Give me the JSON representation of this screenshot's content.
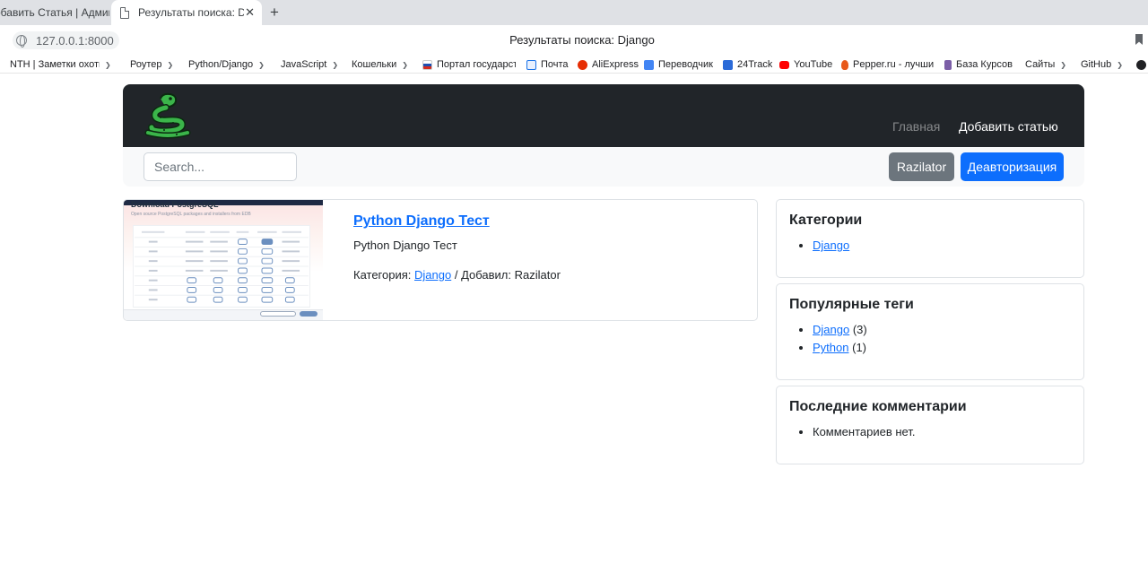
{
  "browser": {
    "tabs": [
      {
        "title": "обавить Статья | Админ...",
        "active": false
      },
      {
        "title": "Результаты поиска: Django",
        "active": true
      }
    ],
    "new_tab": "+",
    "url": "127.0.0.1:8000",
    "page_title": "Результаты поиска: Django",
    "bookmarks": [
      {
        "label": "NTH | Заметки охотн...",
        "folder": true
      },
      {
        "label": "Роутер",
        "folder": true
      },
      {
        "label": "Python/Django",
        "folder": true
      },
      {
        "label": "JavaScript",
        "folder": true
      },
      {
        "label": "Кошельки",
        "folder": true
      },
      {
        "label": "Портал государст...",
        "folder": false,
        "icon_color": "#1e4fb0"
      },
      {
        "label": "Почта",
        "folder": false,
        "icon_color": "#1a73e8"
      },
      {
        "label": "AliExpress",
        "folder": false,
        "icon_color": "#e62e04"
      },
      {
        "label": "Переводчик",
        "folder": false,
        "icon_color": "#4285f4"
      },
      {
        "label": "24Track",
        "folder": false,
        "icon_color": "#2a6ad8"
      },
      {
        "label": "YouTube",
        "folder": false,
        "icon_color": "#ff0000"
      },
      {
        "label": "Pepper.ru - лучши...",
        "folder": false,
        "icon_color": "#e8591a"
      },
      {
        "label": "База Курсов",
        "folder": false,
        "icon_color": "#7b5ea7"
      },
      {
        "label": "Сайты",
        "folder": true
      },
      {
        "label": "GitHub",
        "folder": true
      }
    ]
  },
  "nav": {
    "home": "Главная",
    "add_article": "Добавить статью"
  },
  "search": {
    "placeholder": "Search...",
    "user_button": "Razilator",
    "logout_button": "Деавторизация"
  },
  "post": {
    "title": "Python Django Тест",
    "excerpt": "Python Django Тест",
    "category_label": "Категория:",
    "category": "Django",
    "added_by_label": "/ Добавил:",
    "author": "Razilator",
    "thumbnail": {
      "heading": "Download PostgreSQL",
      "subheading": "Open source PostgreSQL packages and installers from EDB"
    }
  },
  "sidebar": {
    "categories": {
      "title": "Категории",
      "items": [
        "Django"
      ]
    },
    "tags": {
      "title": "Популярные теги",
      "items": [
        {
          "name": "Django",
          "count": "(3)"
        },
        {
          "name": "Python",
          "count": "(1)"
        }
      ]
    },
    "comments": {
      "title": "Последние комментарии",
      "empty": "Комментариев нет."
    }
  },
  "colors": {
    "navbar": "#212529",
    "primary": "#0d6efd",
    "secondary": "#6c757d",
    "logo_green": "#3bb54a"
  }
}
